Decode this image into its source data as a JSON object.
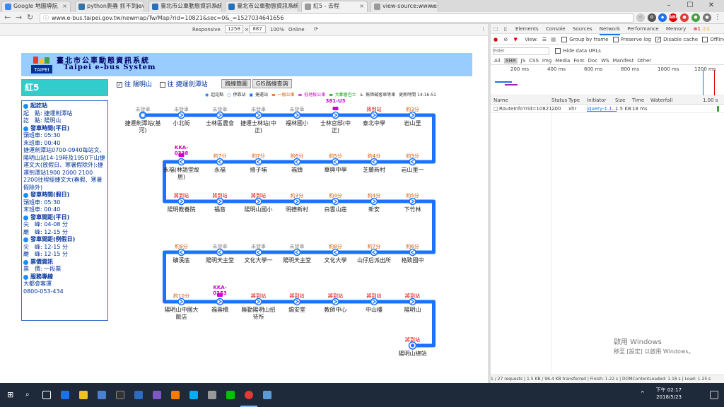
{
  "browser": {
    "tabs": [
      {
        "title": "Google 地圖導航",
        "color": "#4285f4"
      },
      {
        "title": "python爬蟲 抓不到javascri",
        "color": "#3572a5"
      },
      {
        "title": "臺北市公車動態資訊系統 - 陽明山",
        "color": "#2d6fb5"
      },
      {
        "title": "臺北市公車動態資訊系統 - 陽明山",
        "color": "#2d6fb5"
      },
      {
        "title": "紅5 - 去程",
        "color": "#9a9a9a"
      },
      {
        "title": "view-source:www.e-bus",
        "color": "#9a9a9a"
      }
    ],
    "url": "www.e-bus.taipei.gov.tw/newmap/Tw/Map?rid=10821&sec=0&_=1527034641656",
    "device": {
      "mode": "Responsive",
      "width": "1258",
      "height": "887",
      "zoom": "100%",
      "network": "Online"
    },
    "win_buttons": [
      "–",
      "☐",
      "✕"
    ]
  },
  "site": {
    "title_zh": "臺北市公車動態資訊系統",
    "title_en": "Taipei e-bus System",
    "logo_text": "TAIPEI",
    "route_name": "紅5",
    "direction_yes": "往 陽明山",
    "direction_no": "往 捷運劍潭站",
    "btn_route_map": "路線簡圖",
    "btn_gis": "GIS路線查詢",
    "legend": [
      "起訖點",
      "停靠站",
      "捷運站",
      "一般公車",
      "低地板公車",
      "大都會巴士",
      "無障礙客車等車",
      "更新時間 14:16:51"
    ],
    "info": [
      {
        "head": "起訖站",
        "lines": [
          "起　點: 捷運劍潭站",
          "訖　點: 陽明山"
        ]
      },
      {
        "head": "發車時間(平日)",
        "lines": [
          "頭班車: 05:30",
          "末班車: 00:40",
          "捷運劍潭站0700-0940每站文、陽明山站14-19時及1950下山捷運文大(放假日、寒暑假除外):捷運劍潭站1900 2000 2100 2200往程經捷文大(春假、寒暑假除外)"
        ]
      },
      {
        "head": "發車時間(假日)",
        "lines": [
          "頭班車: 05:30",
          "末班車: 00:40"
        ]
      },
      {
        "head": "發車間距(平日)",
        "lines": [
          "尖　峰: 04-08 分",
          "離　峰: 12-15 分"
        ]
      },
      {
        "head": "發車間距(例假日)",
        "lines": [
          "尖　峰: 12-15 分",
          "離　峰: 12-15 分"
        ]
      },
      {
        "head": "票價資訊",
        "lines": [
          "票　價: 一段票"
        ]
      },
      {
        "head": "服務專線",
        "lines": [
          "大都會客運",
          "0800-053-434"
        ]
      }
    ]
  },
  "stops": [
    {
      "row": 0,
      "col": 0,
      "status": "未發車",
      "name": "捷運劍潭站(基河)",
      "red": false
    },
    {
      "row": 0,
      "col": 1,
      "status": "未發車",
      "name": "小北街",
      "red": false
    },
    {
      "row": 0,
      "col": 2,
      "status": "未發車",
      "name": "士林區農會",
      "red": false
    },
    {
      "row": 0,
      "col": 3,
      "status": "未發車",
      "name": "捷運士林站(中正)",
      "red": false
    },
    {
      "row": 0,
      "col": 4,
      "status": "未發車",
      "name": "福林國小",
      "red": false
    },
    {
      "row": 0,
      "col": 5,
      "status": "381-U3",
      "name": "士林官邸(中正)",
      "red": true,
      "bus": true
    },
    {
      "row": 0,
      "col": 6,
      "status": "將到站",
      "name": "泰北中學",
      "red": true
    },
    {
      "row": 0,
      "col": 7,
      "status": "約3分",
      "name": "岩山里",
      "red": false
    },
    {
      "row": 1,
      "col": 7,
      "status": "約3分",
      "name": "岩山里一",
      "red": false
    },
    {
      "row": 1,
      "col": 6,
      "status": "約4分",
      "name": "芝蘭新村",
      "red": false
    },
    {
      "row": 1,
      "col": 5,
      "status": "約5分",
      "name": "華興中學",
      "red": false
    },
    {
      "row": 1,
      "col": 4,
      "status": "約6分",
      "name": "福頭",
      "red": false
    },
    {
      "row": 1,
      "col": 3,
      "status": "約7分",
      "name": "掖子埔",
      "red": false
    },
    {
      "row": 1,
      "col": 2,
      "status": "約7分",
      "name": "永福",
      "red": false
    },
    {
      "row": 1,
      "col": 1,
      "status": "KKA-0338",
      "name": "永福(林語堂故居)",
      "red": true,
      "bus": true
    },
    {
      "row": 2,
      "col": 1,
      "status": "將到站",
      "name": "陽明教養院",
      "red": true
    },
    {
      "row": 2,
      "col": 2,
      "status": "將到站",
      "name": "福音",
      "red": true
    },
    {
      "row": 2,
      "col": 3,
      "status": "將到站",
      "name": "陽明山國小",
      "red": true
    },
    {
      "row": 2,
      "col": 4,
      "status": "約3分",
      "name": "明德新村",
      "red": false
    },
    {
      "row": 2,
      "col": 5,
      "status": "約4分",
      "name": "白雲山莊",
      "red": false
    },
    {
      "row": 2,
      "col": 6,
      "status": "約4分",
      "name": "新安",
      "red": false
    },
    {
      "row": 2,
      "col": 7,
      "status": "約5分",
      "name": "下竹林",
      "red": false
    },
    {
      "row": 3,
      "col": 7,
      "status": "約6分",
      "name": "格致國中",
      "red": false
    },
    {
      "row": 3,
      "col": 6,
      "status": "約7分",
      "name": "山仔后派出所",
      "red": false
    },
    {
      "row": 3,
      "col": 5,
      "status": "約8分",
      "name": "文化大學",
      "red": false
    },
    {
      "row": 3,
      "col": 4,
      "status": "未發車",
      "name": "陽明天主堂",
      "red": false
    },
    {
      "row": 3,
      "col": 3,
      "status": "未發車",
      "name": "文化大學一",
      "red": false
    },
    {
      "row": 3,
      "col": 2,
      "status": "未發車",
      "name": "陽明天主堂",
      "red": false
    },
    {
      "row": 3,
      "col": 1,
      "status": "約9分",
      "name": "礦溪底",
      "red": false
    },
    {
      "row": 4,
      "col": 1,
      "status": "約10分",
      "name": "陽明山中國大飯店",
      "red": false
    },
    {
      "row": 4,
      "col": 2,
      "status": "KKA-0353",
      "name": "福壽橋",
      "red": true,
      "bus": true
    },
    {
      "row": 4,
      "col": 3,
      "status": "將到站",
      "name": "聯勤陽明山招待所",
      "red": true
    },
    {
      "row": 4,
      "col": 4,
      "status": "將到站",
      "name": "錫安堂",
      "red": true
    },
    {
      "row": 4,
      "col": 5,
      "status": "將到站",
      "name": "教師中心",
      "red": true
    },
    {
      "row": 4,
      "col": 6,
      "status": "將到站",
      "name": "中山樓",
      "red": true
    },
    {
      "row": 4,
      "col": 7,
      "status": "將到站",
      "name": "陽明山",
      "red": true
    },
    {
      "row": 5,
      "col": 7,
      "status": "將到站",
      "name": "陽明山總站",
      "red": true,
      "terminal": true
    }
  ],
  "devtools": {
    "tabs": [
      "Elements",
      "Console",
      "Sources",
      "Network",
      "Performance",
      "Memory"
    ],
    "badges": {
      "errors": "1",
      "warnings": "1"
    },
    "toolbar": {
      "view": "View:",
      "group": "Group by frame",
      "preserve": "Preserve log",
      "disable_cache": "Disable cache",
      "offline": "Offline"
    },
    "filter_placeholder": "Filter",
    "hide_data": "Hide data URLs",
    "types": [
      "All",
      "XHR",
      "JS",
      "CSS",
      "Img",
      "Media",
      "Font",
      "Doc",
      "WS",
      "Manifest",
      "Other"
    ],
    "timeline": [
      "200 ms",
      "400 ms",
      "600 ms",
      "800 ms",
      "1000 ms",
      "1200 ms"
    ],
    "cols": [
      "Name",
      "Status",
      "Type",
      "Initiator",
      "Size",
      "Time",
      "Waterfall"
    ],
    "waterfall_scale": "1.00 s",
    "row": {
      "name": "RouteInfo?rid=10821...",
      "status": "200",
      "type": "xhr",
      "initiator": "jquery-1.1...",
      "size": "1.5 KB",
      "time": "18 ms"
    },
    "status": "1 / 27 requests | 1.5 KB / 96.4 KB transferred | Finish: 1.22 s | DOMContentLoaded: 1.18 s | Load: 1.25 s"
  },
  "watermark": [
    "啟用 Windows",
    "移至 [設定] 以啟用 Windows。"
  ],
  "clock": {
    "time": "下午 02:17",
    "date": "2018/5/23"
  }
}
